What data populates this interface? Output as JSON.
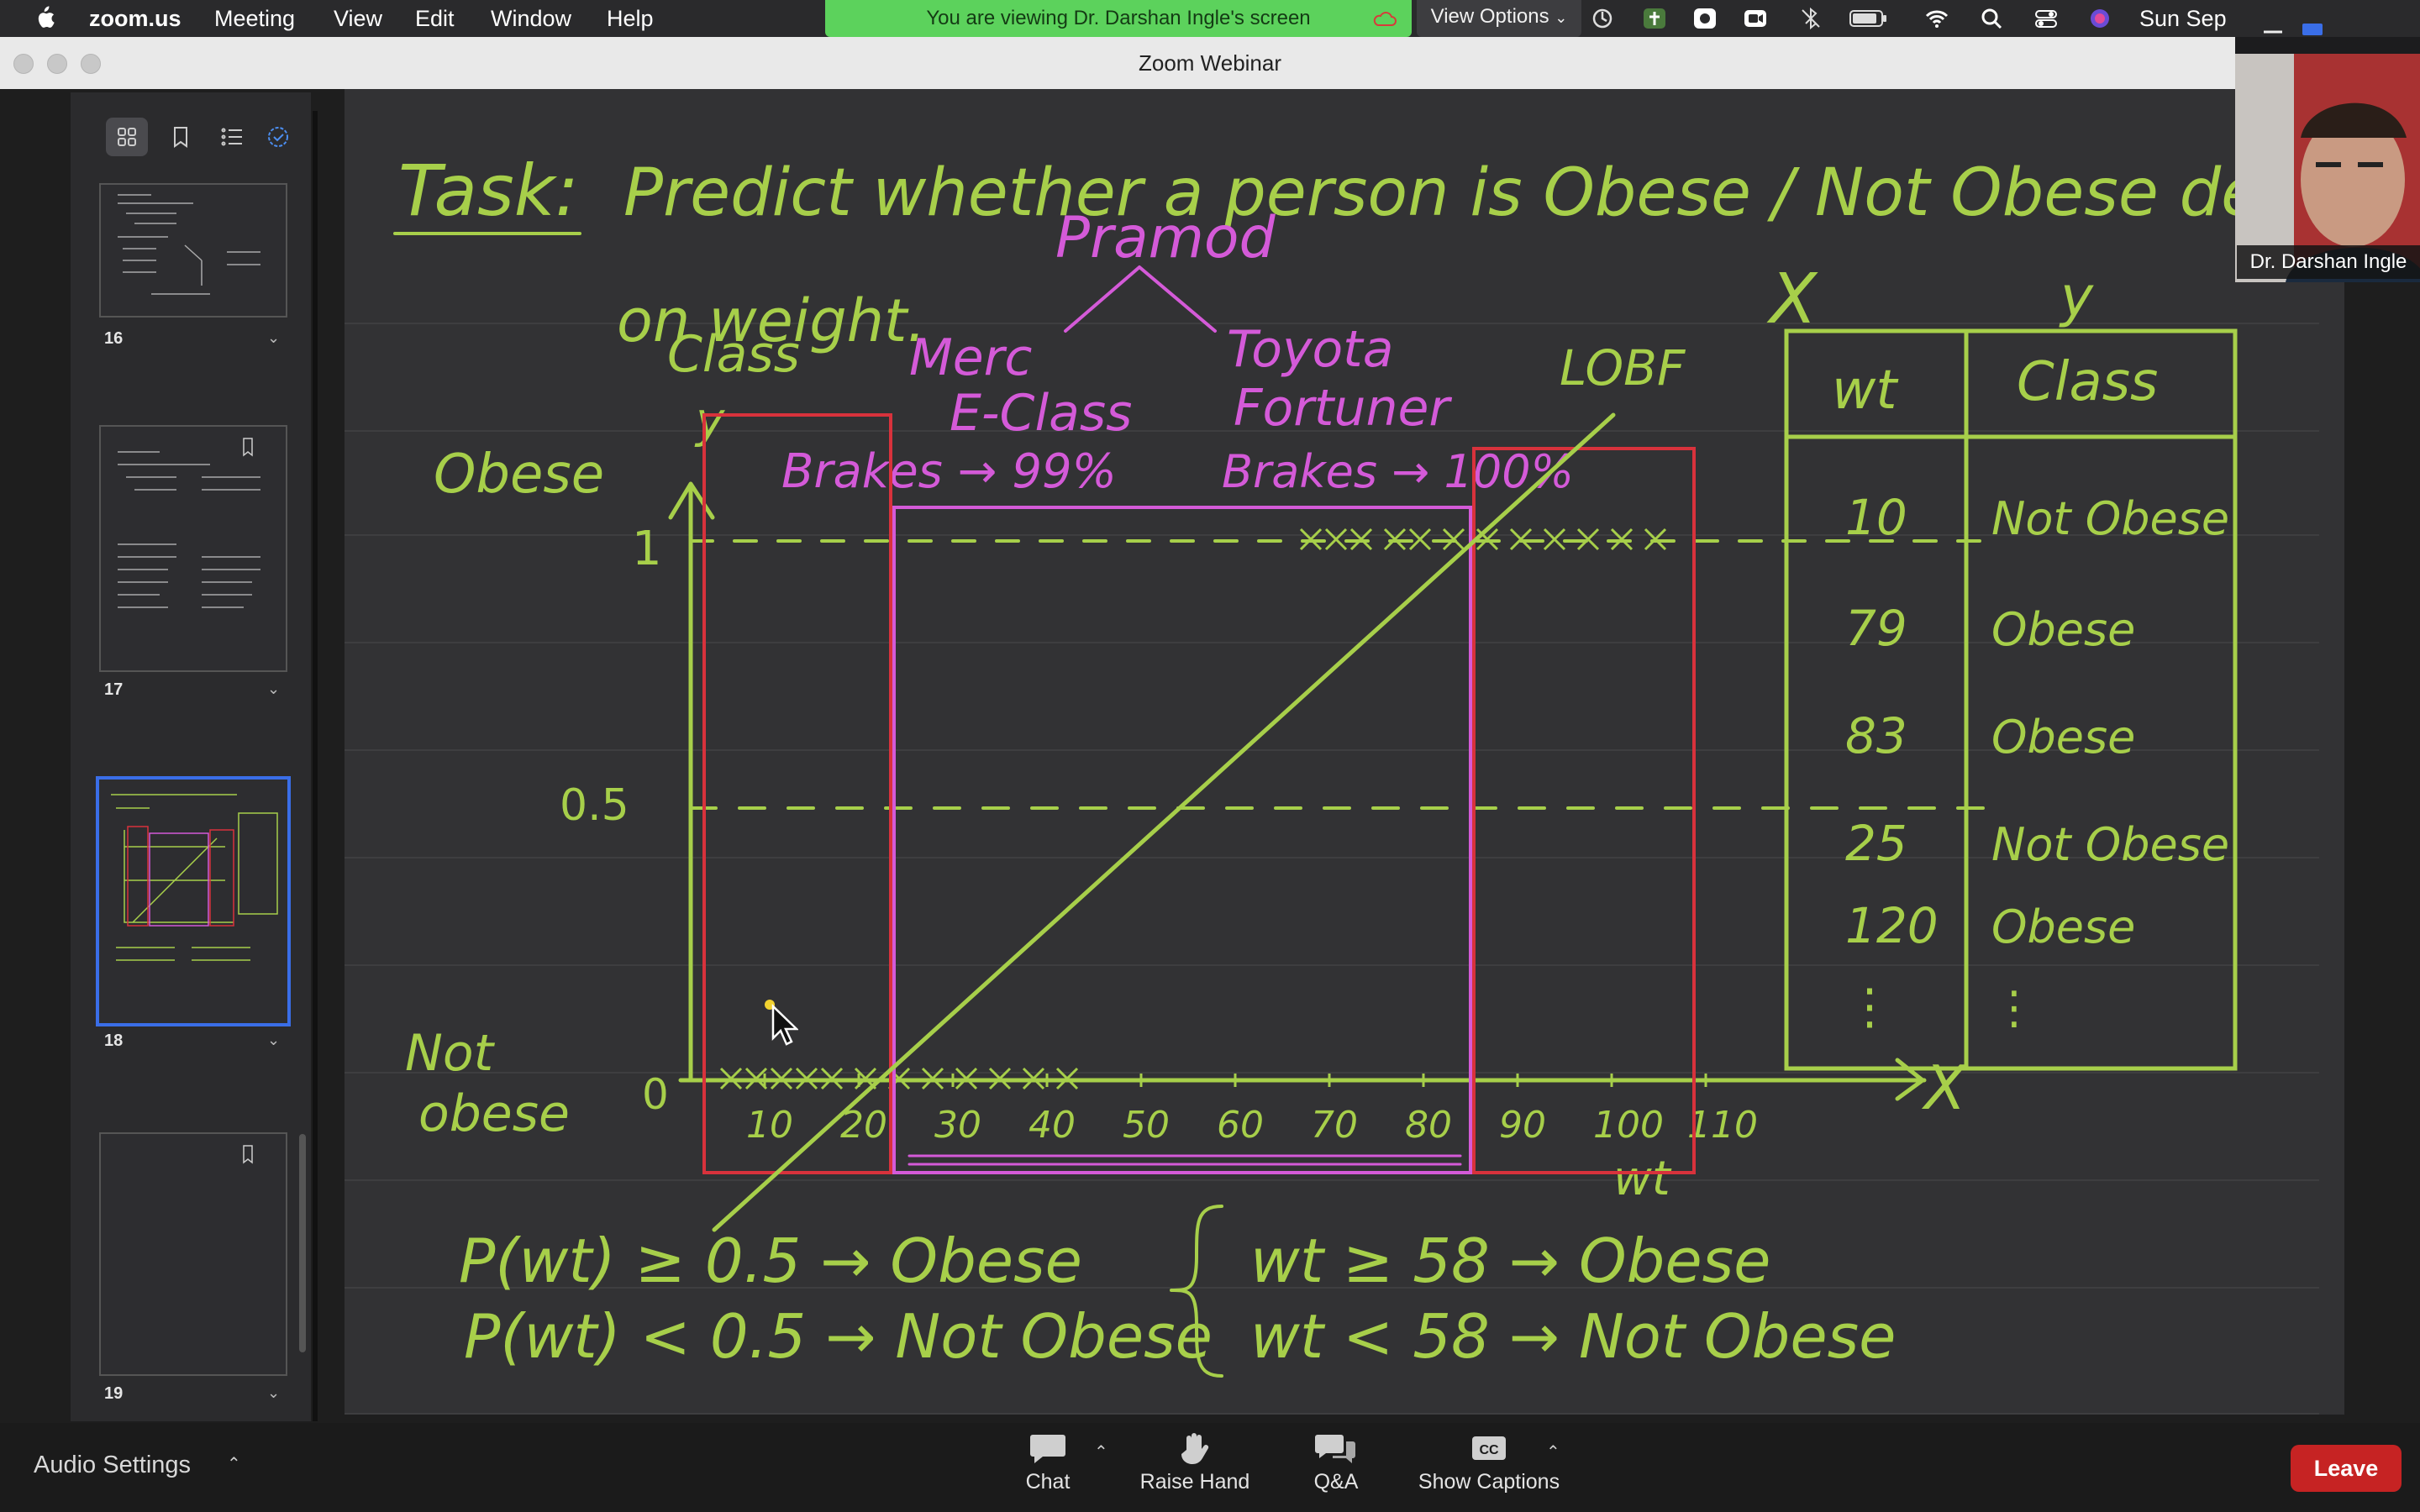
{
  "menubar": {
    "app_name": "zoom.us",
    "items": [
      "Meeting",
      "View",
      "Edit",
      "Window",
      "Help"
    ],
    "share_banner": "You are viewing Dr. Darshan Ingle's screen",
    "view_options": "View Options",
    "clock": "Sun Sep"
  },
  "window": {
    "title": "Zoom Webinar"
  },
  "sidebar": {
    "pages": [
      {
        "number": "16"
      },
      {
        "number": "17"
      },
      {
        "number": "18",
        "selected": true
      },
      {
        "number": "19"
      }
    ]
  },
  "whiteboard": {
    "task_label": "Task:",
    "task_text": "Predict whether a person is   Obese / Not Obese   depending",
    "task_text2": "on weight.",
    "name_label": "Pramod",
    "merc_label": "Merc",
    "merc_label2": "E-Class",
    "merc_brakes": "Brakes → 99%",
    "toyota_label": "Toyota",
    "toyota_label2": "Fortuner",
    "toyota_brakes": "Brakes → 100%",
    "lobf_label": "LOBF",
    "class_label": "Class",
    "y_label": "y",
    "x_label": "X",
    "wt_label": "wt",
    "obese_label": "Obese",
    "notobese_label": "Not",
    "notobese_label2": "obese",
    "y_ticks": [
      "1",
      "0.5",
      "0"
    ],
    "x_ticks": [
      "10",
      "20",
      "30",
      "40",
      "50",
      "60",
      "70",
      "80",
      "90",
      "100",
      "110"
    ],
    "rule1_left": "P(wt) ≥ 0.5 → Obese",
    "rule2_left": "P(wt) < 0.5 → Not Obese",
    "rule1_right": "wt ≥ 58 → Obese",
    "rule2_right": "wt < 58 → Not Obese",
    "table": {
      "header_x": "X",
      "header_y": "y",
      "columns": [
        "wt",
        "Class"
      ],
      "rows": [
        [
          "10",
          "Not Obese"
        ],
        [
          "79",
          "Obese"
        ],
        [
          "83",
          "Obese"
        ],
        [
          "25",
          "Not Obese"
        ],
        [
          "120",
          "Obese"
        ],
        [
          "⋮",
          "⋮"
        ]
      ]
    }
  },
  "video": {
    "participant": "Dr. Darshan Ingle"
  },
  "toolbar": {
    "audio_settings": "Audio Settings",
    "chat": "Chat",
    "raise_hand": "Raise Hand",
    "qa": "Q&A",
    "captions": "Show Captions",
    "cc": "CC",
    "leave": "Leave"
  },
  "colors": {
    "ink_green": "#a7cf4a",
    "ink_pink": "#d45ad8",
    "ink_red": "#d8323c",
    "banner_green": "#5cd25c",
    "leave_red": "#c62323",
    "selection_blue": "#3a6ee8"
  }
}
